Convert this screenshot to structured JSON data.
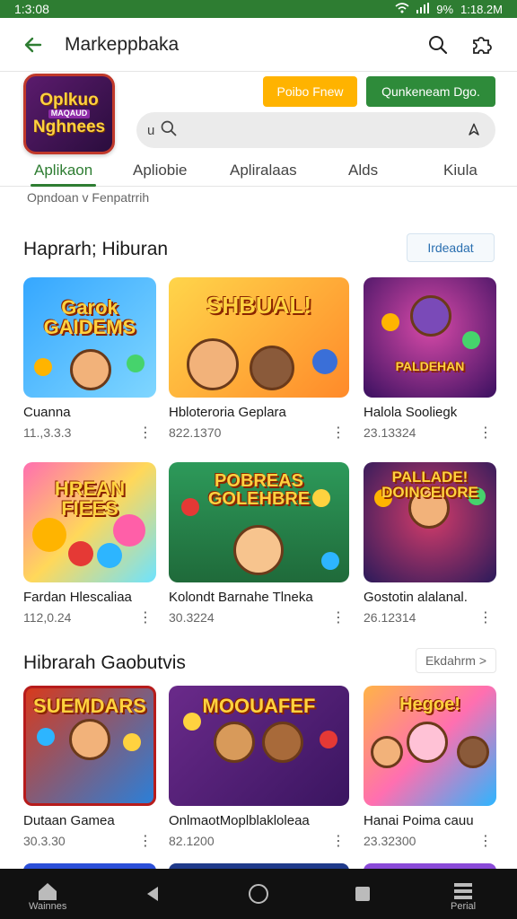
{
  "status_bar": {
    "time": "1:3:08",
    "battery": "9%",
    "clock_right": "1:18.2M"
  },
  "app_bar": {
    "title": "Markeppbaka"
  },
  "header": {
    "logo_line1": "Oplkuo",
    "logo_small": "MAQAUD",
    "logo_line2": "Nghnees",
    "orange_button": "Poibo Fnew",
    "green_button": "Qunkeneam Dgo.",
    "search_prefix": "u",
    "search_value": ""
  },
  "tabs": [
    "Aplikaon",
    "Apliobie",
    "Apliralaas",
    "Alds",
    "Kiulа"
  ],
  "filter": {
    "label": "Opndoan v  Fenpatrrih"
  },
  "section1": {
    "title": "Haprarh; Hiburan",
    "more": "Irdeadat",
    "apps": [
      {
        "art": "Garok GAIDEMS",
        "name": "Cuanna",
        "meta": "11.,3.3.3",
        "colors": [
          "#35a7ff",
          "#54c6ff"
        ]
      },
      {
        "art": "SHBUAL!",
        "name": "Hbloteroria Geplara",
        "meta": "822.1370",
        "colors": [
          "#ff7a1a",
          "#ffd54a"
        ]
      },
      {
        "art": "PALDEHAN",
        "name": "Halola Sooliegk",
        "meta": "23.13324",
        "colors": [
          "#5a1f7a",
          "#c23ea0"
        ]
      },
      {
        "art": "HREAN FIEES",
        "name": "Fardan Hlescaliaa",
        "meta": "112,0.24",
        "colors": [
          "#ff5fa8",
          "#6de3ff"
        ]
      },
      {
        "art": "POBREAS GOLEHBRE",
        "name": "Kolondt Barnahe Tlneka",
        "meta": "30.3224",
        "colors": [
          "#1f8a4c",
          "#7bd14a"
        ]
      },
      {
        "art": "PALLADE! DOINCEIORE",
        "name": "Gostotin alalanal.",
        "meta": "26.12314",
        "colors": [
          "#3a1f7a",
          "#d43c6a"
        ]
      }
    ]
  },
  "section2": {
    "title": "Hibrarah Gaobutvis",
    "more": "Ekdahrm  >",
    "apps": [
      {
        "art": "SUEMDARS",
        "name": "Dutaan Gamea",
        "meta": "30.3.30",
        "colors": [
          "#d83a1c",
          "#2b7fd8"
        ]
      },
      {
        "art": "MOOUAFEF",
        "name": "OnlmaotMoplblakloleaa",
        "meta": "82.1200",
        "colors": [
          "#6a2a8a",
          "#e0762a"
        ]
      },
      {
        "art": "Hegoe!",
        "name": "Hanai Poima cauu",
        "meta": "23.32300",
        "colors": [
          "#ffb347",
          "#2db5ff"
        ]
      }
    ]
  },
  "nav": {
    "home_label": "Wainnes",
    "menu_label": "Perial"
  },
  "colors": {
    "accent": "#2e7d32",
    "orange": "#ffb300",
    "green_btn": "#2e8b3a"
  }
}
